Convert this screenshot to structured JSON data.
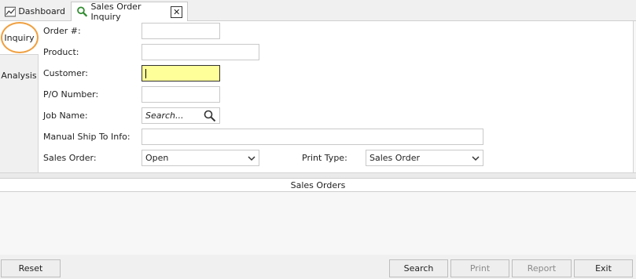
{
  "tabs": {
    "dashboard": "Dashboard",
    "sales_order_inquiry": "Sales Order Inquiry"
  },
  "side_tabs": {
    "inquiry": "Inquiry",
    "analysis": "Analysis"
  },
  "form": {
    "order_label": "Order #:",
    "product_label": "Product:",
    "customer_label": "Customer:",
    "po_label": "P/O Number:",
    "job_label": "Job Name:",
    "job_placeholder": "Search...",
    "ship_label": "Manual Ship To Info:",
    "sales_order_label": "Sales Order:",
    "sales_order_value": "Open",
    "print_type_label": "Print Type:",
    "print_type_value": "Sales Order"
  },
  "grid": {
    "title": "Sales Orders"
  },
  "footer": {
    "reset": "Reset",
    "search": "Search",
    "print": "Print",
    "report": "Report",
    "exit": "Exit"
  },
  "colors": {
    "focus_field": "#ffff99",
    "highlight_ring": "#f0a040",
    "search_icon": "#2e8b2e"
  }
}
